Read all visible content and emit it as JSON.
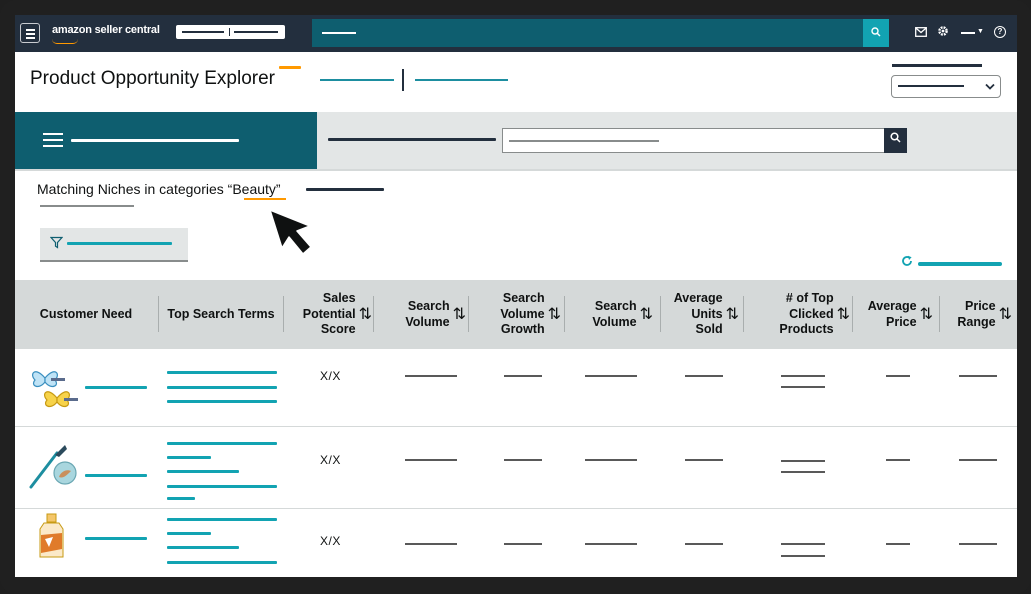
{
  "app": {
    "logo": "amazon seller central",
    "colors": {
      "topbar": "#232f3e",
      "teal": "#0e5e6f",
      "accent": "#12a3b2",
      "orange": "#ff9900"
    }
  },
  "topbar_icons": [
    "menu-icon",
    "search-icon",
    "mail-icon",
    "gear-icon",
    "help-icon"
  ],
  "header": {
    "title": "Product Opportunity Explorer"
  },
  "niches": {
    "title_prefix": "Matching Niches in categories ",
    "keyword": "“Beauty”"
  },
  "table": {
    "columns": [
      {
        "label": "Customer Need",
        "sortable": false
      },
      {
        "label": "Top Search Terms",
        "sortable": false
      },
      {
        "label": "Sales\nPotential\nScore",
        "sortable": true
      },
      {
        "label": "Search\nVolume",
        "sortable": true
      },
      {
        "label": "Search\nVolume\nGrowth",
        "sortable": true
      },
      {
        "label": "Search\nVolume",
        "sortable": true
      },
      {
        "label": "Average\nUnits\nSold",
        "sortable": true
      },
      {
        "label": "# of Top\nClicked\nProducts",
        "sortable": true
      },
      {
        "label": "Average\nPrice",
        "sortable": true
      },
      {
        "label": "Price\nRange",
        "sortable": true
      }
    ],
    "rows": [
      {
        "image": "butterfly-hair-clips",
        "score": "X/X"
      },
      {
        "image": "makeup-brush-and-compact",
        "score": "X/X"
      },
      {
        "image": "perfume-bottle",
        "score": "X/X"
      }
    ]
  }
}
